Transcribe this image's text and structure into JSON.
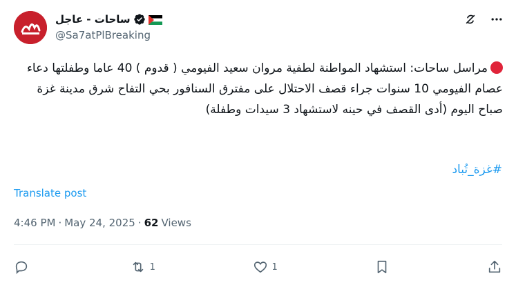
{
  "author": {
    "display_name": "ساحات - عاجل",
    "handle": "@Sa7atPlBreaking",
    "avatar_text": "ساحات",
    "verified": true,
    "flag_icon": "palestine-flag-icon"
  },
  "header_icons": [
    "grok-icon",
    "more-options-icon"
  ],
  "tweet": {
    "text": "مراسل ساحات: استشهاد المواطنة لطفية مروان سعيد الفيومي ( قدوم ) 40 عاما وطفلتها دعاء عصام الفيومي 10 سنوات جراء قصف الاحتلال على مفترق السنافور بحي التفاح شرق مدينة غزة  صباح اليوم (أدى القصف في حينه لاستشهاد 3 سيدات وطفلة)",
    "hashtag": "#غزة_تُباد",
    "translate_label": "Translate post"
  },
  "meta": {
    "time": "4:46 PM",
    "separator": "·",
    "date": "May 24, 2025",
    "views_count": "62",
    "views_label": "Views"
  },
  "actions": {
    "reply_count": "",
    "retweet_count": "1",
    "like_count": "1"
  },
  "colors": {
    "accent": "#1d9bf0",
    "secondary_text": "#536471",
    "avatar_bg": "#c8202c"
  }
}
